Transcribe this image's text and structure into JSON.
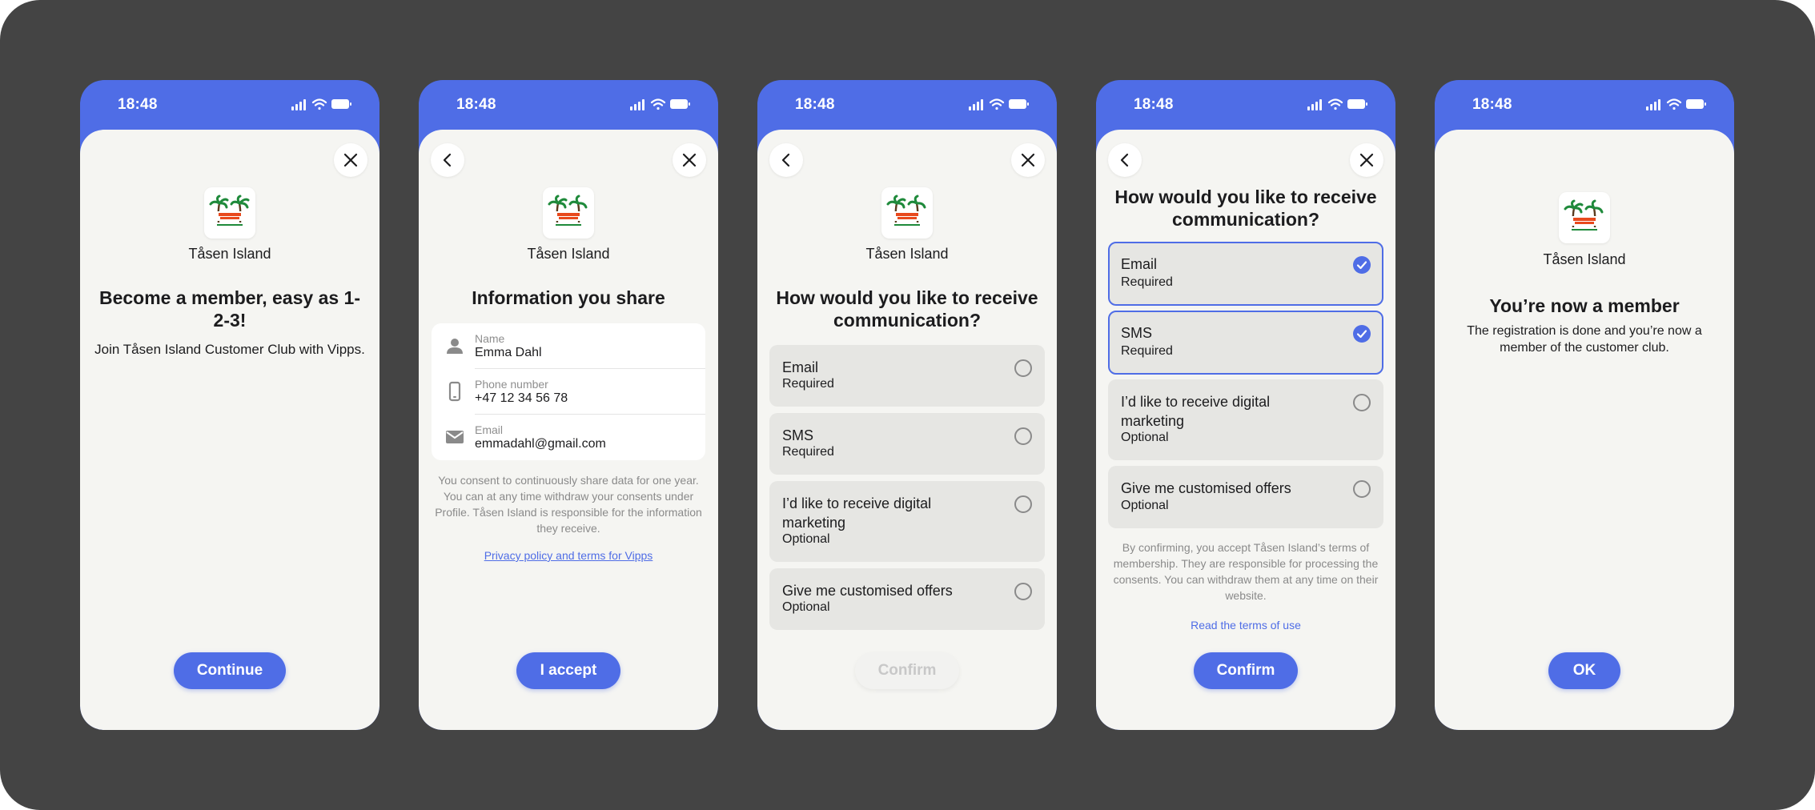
{
  "status": {
    "time": "18:48"
  },
  "merchant": {
    "name": "Tåsen Island",
    "logo_text": "Tåsen Island"
  },
  "screens": [
    {
      "title": "Become a member, easy as 1-2-3!",
      "subtitle": "Join Tåsen Island Customer Club with Vipps.",
      "button": "Continue"
    },
    {
      "title": "Information you share",
      "fields": [
        {
          "label": "Name",
          "value": "Emma Dahl",
          "icon": "person-icon"
        },
        {
          "label": "Phone number",
          "value": "+47 12 34 56 78",
          "icon": "phone-icon"
        },
        {
          "label": "Email",
          "value": "emmadahl@gmail.com",
          "icon": "mail-icon"
        }
      ],
      "consent_text": "You consent to continuously share data for one year. You can at any time withdraw your consents under Profile. Tåsen Island is responsible for the information they receive.",
      "privacy_link": "Privacy policy and terms for Vipps",
      "button": "I accept"
    },
    {
      "title": "How would you like to receive communication?",
      "options": [
        {
          "title": "Email",
          "sub": "Required",
          "checked": false
        },
        {
          "title": "SMS",
          "sub": "Required",
          "checked": false
        },
        {
          "title": "I’d like to receive digital marketing",
          "sub": "Optional",
          "checked": false
        },
        {
          "title": "Give me customised offers",
          "sub": "Optional",
          "checked": false
        }
      ],
      "button": "Confirm",
      "button_disabled": true
    },
    {
      "title": "How would you like to receive communication?",
      "options": [
        {
          "title": "Email",
          "sub": "Required",
          "checked": true
        },
        {
          "title": "SMS",
          "sub": "Required",
          "checked": true
        },
        {
          "title": "I’d like to receive digital marketing",
          "sub": "Optional",
          "checked": false
        },
        {
          "title": "Give me customised offers",
          "sub": "Optional",
          "checked": false
        }
      ],
      "terms_text": "By confirming, you accept Tåsen Island’s terms of membership. They are responsible for processing the consents. You can withdraw them at any time on their website.",
      "terms_link": "Read the terms of use",
      "button": "Confirm"
    },
    {
      "title": "You’re now a member",
      "subtitle": "The registration is done and you’re now a member of the customer club.",
      "button": "OK"
    }
  ],
  "colors": {
    "accent": "#4f6de6",
    "backdrop": "#444444",
    "sheet": "#f5f5f2"
  }
}
